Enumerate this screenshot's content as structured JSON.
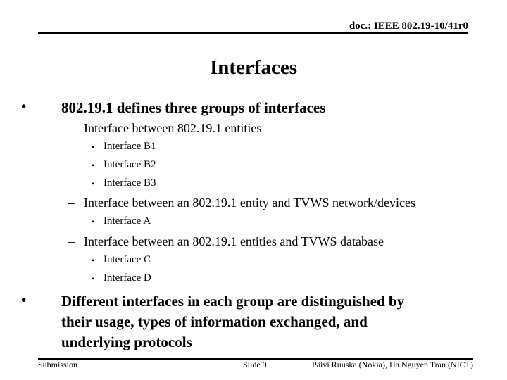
{
  "header": {
    "doc_id": "doc.: IEEE 802.19-10/41r0"
  },
  "slide": {
    "title": "Interfaces",
    "bullets": [
      {
        "text": "802.19.1 defines three groups of interfaces",
        "children": [
          {
            "text": "Interface between 802.19.1 entities",
            "children": [
              "Interface B1",
              "Interface B2",
              "Interface B3"
            ]
          },
          {
            "text": "Interface between an 802.19.1 entity and TVWS network/devices",
            "children": [
              "Interface A"
            ]
          },
          {
            "text": "Interface between an 802.19.1 entities and  TVWS database",
            "children": [
              "Interface C",
              "Interface D"
            ]
          }
        ]
      },
      {
        "lines": [
          "Different interfaces in each group are distinguished by",
          "their usage, types of information exchanged, and",
          "underlying protocols"
        ]
      }
    ],
    "bullet_glyphs": {
      "level1": "•",
      "level2": "–",
      "level3": "•"
    }
  },
  "footer": {
    "left": "Submission",
    "center": "Slide 9",
    "right": "Päivi Ruuska (Nokia), Ha Nguyen Tran (NICT)"
  }
}
